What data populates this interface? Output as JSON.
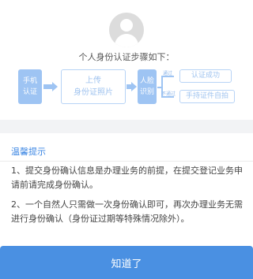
{
  "steps": {
    "title": "个人身份认证步骤如下：",
    "step1": {
      "line1": "手机",
      "line2": "认证"
    },
    "step2": {
      "line1": "上传",
      "line2": "身份证照片"
    },
    "step3": {
      "line1": "人脸",
      "line2": "识别"
    },
    "pass_label": "通过",
    "fail_label": "不通过",
    "result_success": "认证成功",
    "result_manual": "手持证件自拍"
  },
  "notice": {
    "title": "温馨提示",
    "item1": "1、提交身份确认信息是办理业务的前提，在提交登记业务申请前请完成身份确认。",
    "item2": "2、一个自然人只需做一次身份确认即可，再次办理业务无需进行身份确认（身份证过期等特殊情况除外）。"
  },
  "footer": {
    "confirm_label": "知道了"
  },
  "colors": {
    "accent": "#4a90e2",
    "flow": "#9ec4f3",
    "title": "#3b86e3"
  },
  "icons": {
    "avatar": "user-avatar-icon"
  }
}
